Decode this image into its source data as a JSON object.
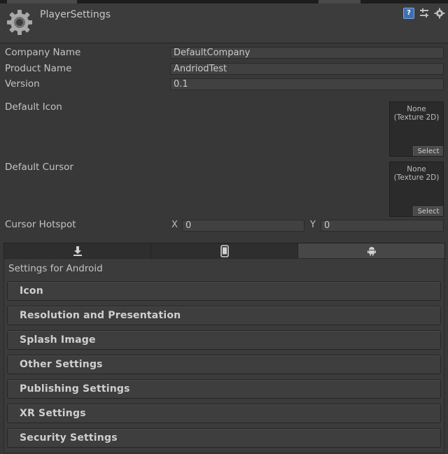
{
  "window": {
    "title": "PlayerSettings"
  },
  "header_icons": [
    "help-icon",
    "presets-icon",
    "gear-icon"
  ],
  "fields": {
    "company_name_label": "Company Name",
    "company_name_value": "DefaultCompany",
    "product_name_label": "Product Name",
    "product_name_value": "AndriodTest",
    "version_label": "Version",
    "version_value": "0.1"
  },
  "default_icon": {
    "label": "Default Icon",
    "value_line1": "None",
    "value_line2": "(Texture 2D)",
    "select_label": "Select"
  },
  "default_cursor": {
    "label": "Default Cursor",
    "value_line1": "None",
    "value_line2": "(Texture 2D)",
    "select_label": "Select"
  },
  "cursor_hotspot": {
    "label": "Cursor Hotspot",
    "x_label": "X",
    "x_value": "0",
    "y_label": "Y",
    "y_value": "0"
  },
  "platform_tabs": [
    {
      "icon": "download-icon",
      "active": false
    },
    {
      "icon": "phone-icon",
      "active": false
    },
    {
      "icon": "android-icon",
      "active": true
    }
  ],
  "settings": {
    "title": "Settings for Android",
    "sections": [
      "Icon",
      "Resolution and Presentation",
      "Splash Image",
      "Other Settings",
      "Publishing Settings",
      "XR Settings",
      "Security Settings"
    ]
  }
}
